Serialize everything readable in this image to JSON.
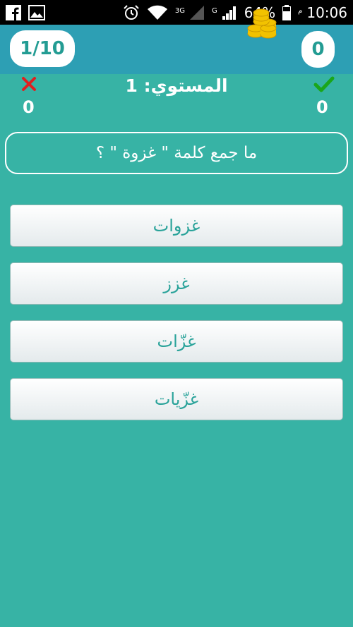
{
  "status_bar": {
    "clock": "10:06",
    "am_pm": "م",
    "battery": "64%",
    "net_3g": "3G",
    "net_g": "G",
    "icons": [
      "facebook-icon",
      "gallery-icon",
      "alarm-icon",
      "wifi-icon",
      "signal-icon",
      "battery-icon"
    ]
  },
  "header": {
    "progress": "1/10",
    "coins": "0",
    "colors": {
      "bar": "#2d9fb4",
      "pill_text": "#239c93"
    }
  },
  "score": {
    "wrong_count": "0",
    "right_count": "0",
    "level_text": "المستوي: 1"
  },
  "question": {
    "text": "ما جمع كلمة \" غزوة \" ؟"
  },
  "answers": [
    {
      "label": "غزوات"
    },
    {
      "label": "غزز"
    },
    {
      "label": "غزّات"
    },
    {
      "label": "غزّيات"
    }
  ],
  "theme": {
    "background": "#37b3a5",
    "wrong_color": "#e02020",
    "right_color": "#1aa61a",
    "coin_color": "#f2c200"
  }
}
